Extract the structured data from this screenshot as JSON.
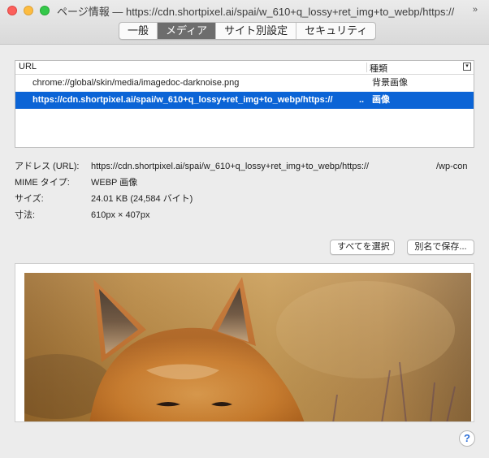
{
  "window": {
    "title": "ページ情報 — https://cdn.shortpixel.ai/spai/w_610+q_lossy+ret_img+to_webp/https://"
  },
  "tabs": [
    {
      "label": "一般"
    },
    {
      "label": "メディア"
    },
    {
      "label": "サイト別設定"
    },
    {
      "label": "セキュリティ"
    }
  ],
  "media_list": {
    "columns": {
      "url": "URL",
      "type": "種類"
    },
    "rows": [
      {
        "url": "chrome://global/skin/media/imagedoc-darknoise.png",
        "type": "背景画像"
      },
      {
        "url": "https://cdn.shortpixel.ai/spai/w_610+q_lossy+ret_img+to_webp/https://",
        "dots": "..",
        "type": "画像"
      }
    ]
  },
  "details": {
    "address_label": "アドレス (URL):",
    "address_value": "https://cdn.shortpixel.ai/spai/w_610+q_lossy+ret_img+to_webp/https://",
    "address_tail": "/wp-con",
    "mime_label": "MIME タイプ:",
    "mime_value": "WEBP 画像",
    "size_label": "サイズ:",
    "size_value": "24.01 KB (24,584 バイト)",
    "dims_label": "寸法:",
    "dims_value": "610px × 407px"
  },
  "buttons": {
    "select_all": "すべてを選択",
    "save_as": "別名で保存..."
  },
  "help": {
    "label": "?"
  },
  "colors": {
    "selection": "#0b64d6",
    "active_tab": "#6d6d6d",
    "help_accent": "#2c6ed6"
  }
}
